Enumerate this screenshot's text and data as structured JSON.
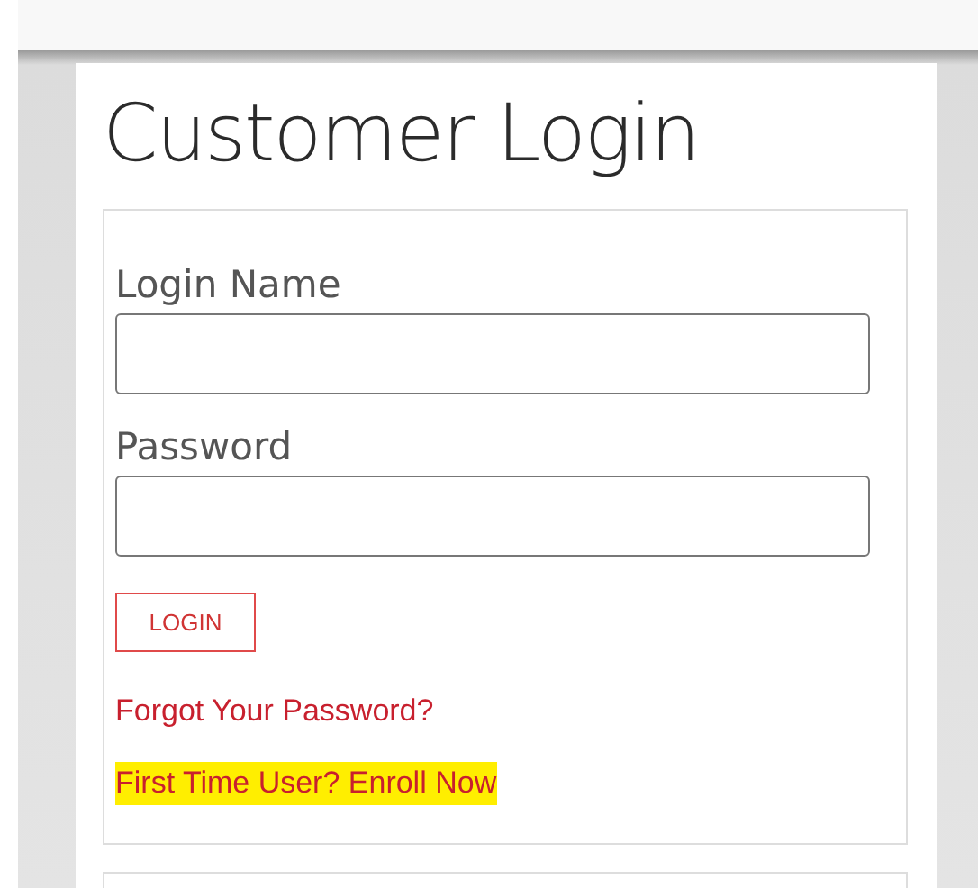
{
  "title": "Customer Login",
  "fields": [
    {
      "label": "Login Name"
    },
    {
      "label": "Password"
    }
  ],
  "login_button": "LOGIN",
  "links": [
    {
      "label": "Forgot Your Password?",
      "highlighted": false
    },
    {
      "label": "First Time User? Enroll Now",
      "highlighted": true
    }
  ]
}
